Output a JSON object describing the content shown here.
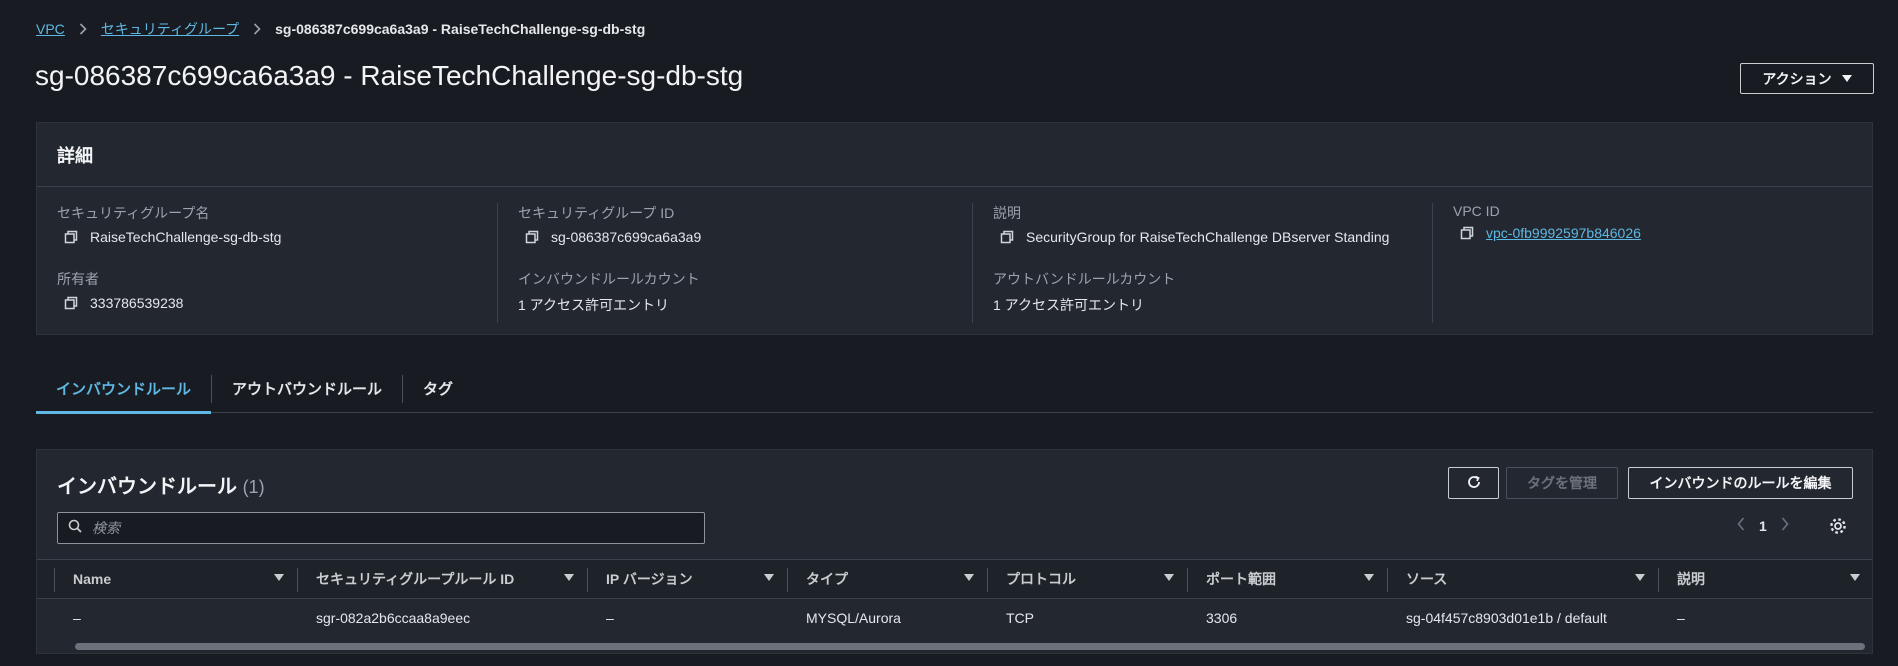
{
  "breadcrumb": {
    "vpc": "VPC",
    "security_groups": "セキュリティグループ",
    "current": "sg-086387c699ca6a3a9 - RaiseTechChallenge-sg-db-stg"
  },
  "page": {
    "title": "sg-086387c699ca6a3a9 - RaiseTechChallenge-sg-db-stg",
    "actions_label": "アクション"
  },
  "details": {
    "heading": "詳細",
    "sg_name_label": "セキュリティグループ名",
    "sg_name_value": "RaiseTechChallenge-sg-db-stg",
    "sg_id_label": "セキュリティグループ ID",
    "sg_id_value": "sg-086387c699ca6a3a9",
    "description_label": "説明",
    "description_value": "SecurityGroup for RaiseTechChallenge DBserver Standing",
    "vpc_id_label": "VPC ID",
    "vpc_id_value": "vpc-0fb9992597b846026",
    "owner_label": "所有者",
    "owner_value": "333786539238",
    "inbound_count_label": "インバウンドルールカウント",
    "inbound_count_value": "1 アクセス許可エントリ",
    "outbound_count_label": "アウトバンドルールカウント",
    "outbound_count_value": "1 アクセス許可エントリ"
  },
  "tabs": [
    {
      "label": "インバウンドルール",
      "active": true
    },
    {
      "label": "アウトバウンドルール",
      "active": false
    },
    {
      "label": "タグ",
      "active": false
    }
  ],
  "inbound": {
    "title": "インバウンドルール",
    "count": "(1)",
    "manage_tags_label": "タグを管理",
    "edit_rules_label": "インバウンドのルールを編集",
    "search_placeholder": "検索",
    "page_number": "1",
    "columns": [
      "Name",
      "セキュリティグループルール ID",
      "IP バージョン",
      "タイプ",
      "プロトコル",
      "ポート範囲",
      "ソース",
      "説明"
    ],
    "rows": [
      [
        "–",
        "sgr-082a2b6ccaa8a9eec",
        "–",
        "MYSQL/Aurora",
        "TCP",
        "3306",
        "sg-04f457c8903d01e1b / default",
        "–"
      ]
    ]
  },
  "colors": {
    "background": "#181c22",
    "panel": "#232830",
    "accent": "#5fb8e3"
  }
}
